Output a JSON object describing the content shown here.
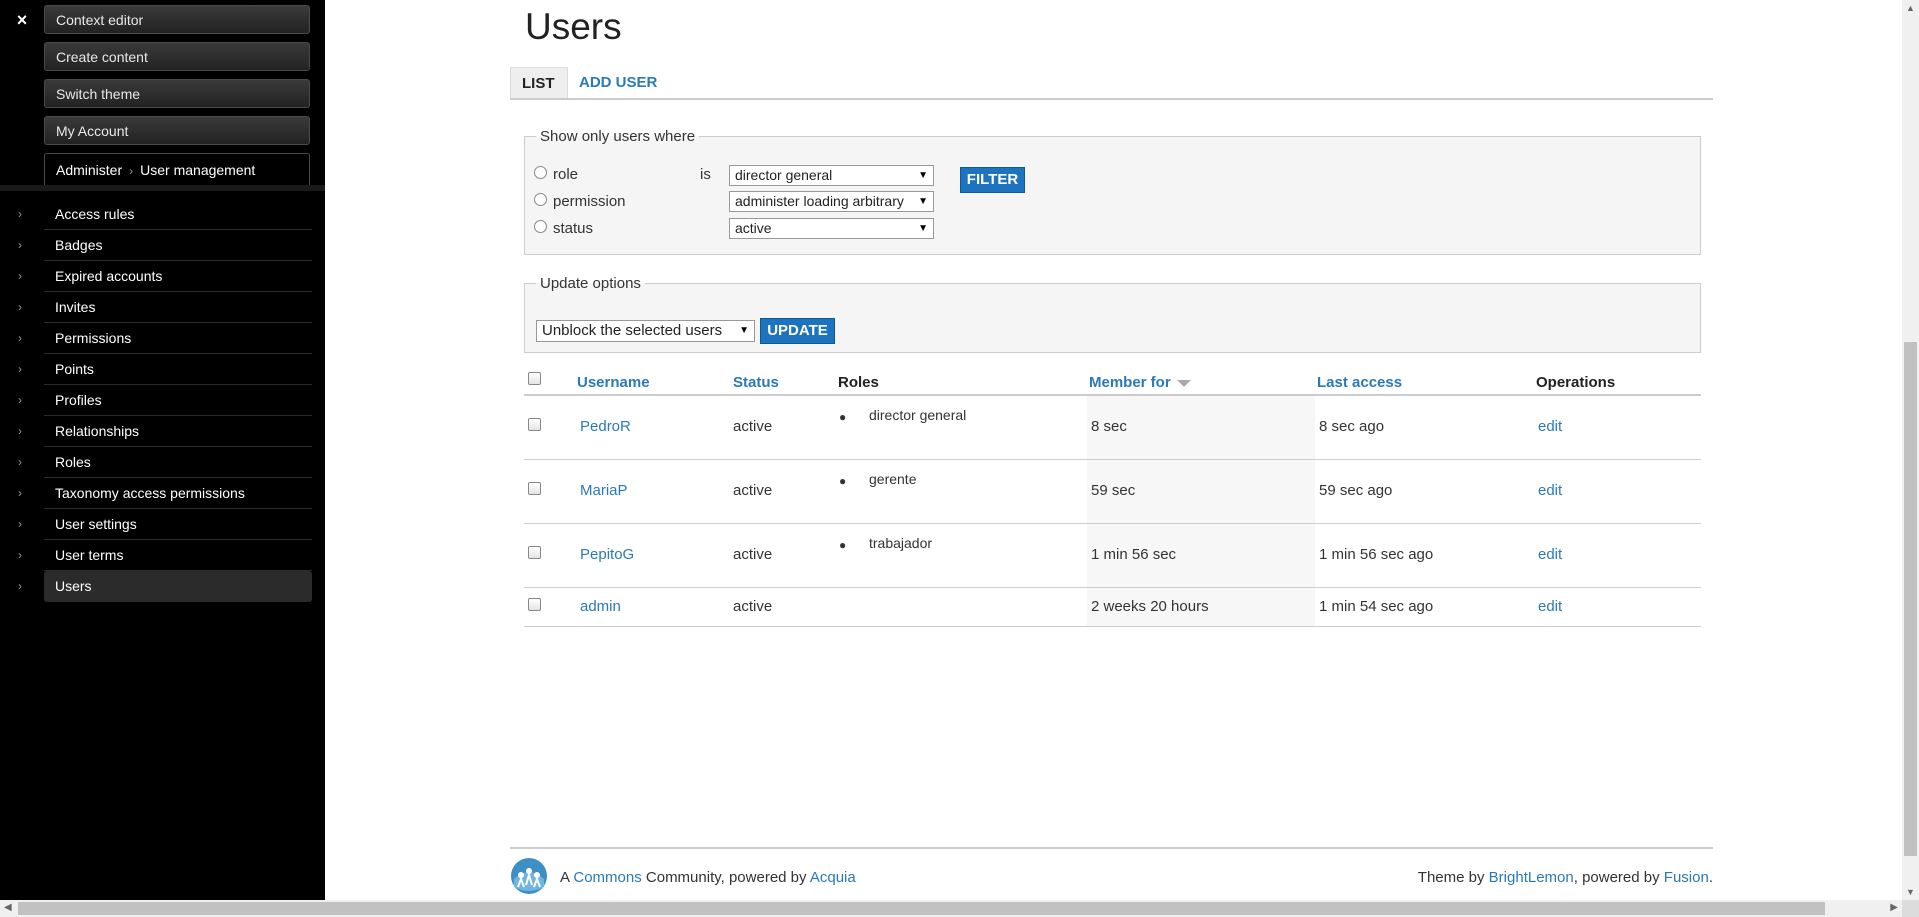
{
  "sidebar": {
    "close": "×",
    "top_buttons": [
      "Context editor",
      "Create content",
      "Switch theme",
      "My Account"
    ],
    "breadcrumb": {
      "parent": "Administer",
      "separator": "›",
      "current": "User management"
    },
    "items": [
      {
        "label": "Access rules"
      },
      {
        "label": "Badges"
      },
      {
        "label": "Expired accounts"
      },
      {
        "label": "Invites"
      },
      {
        "label": "Permissions"
      },
      {
        "label": "Points"
      },
      {
        "label": "Profiles"
      },
      {
        "label": "Relationships"
      },
      {
        "label": "Roles"
      },
      {
        "label": "Taxonomy access permissions"
      },
      {
        "label": "User settings"
      },
      {
        "label": "User terms"
      },
      {
        "label": "Users"
      }
    ],
    "item_arrow": "›"
  },
  "main": {
    "title": "Users",
    "tabs": [
      "List",
      "Add user"
    ],
    "filter": {
      "legend": "Show only users where",
      "rows": [
        {
          "label": "role",
          "operator": "is",
          "value": "director general"
        },
        {
          "label": "permission",
          "operator": "",
          "value": "administer loading arbitrary"
        },
        {
          "label": "status",
          "operator": "",
          "value": "active"
        }
      ],
      "button": "Filter"
    },
    "update": {
      "legend": "Update options",
      "selected": "Unblock the selected users",
      "button": "Update"
    },
    "table": {
      "headers": {
        "username": "Username",
        "status": "Status",
        "roles": "Roles",
        "member_for": "Member for",
        "last_access": "Last access",
        "operations": "Operations"
      },
      "rows": [
        {
          "username": "PedroR",
          "status": "active",
          "role": "director general",
          "member_for": "8 sec",
          "last_access": "8 sec ago",
          "op": "edit"
        },
        {
          "username": "MariaP",
          "status": "active",
          "role": "gerente",
          "member_for": "59 sec",
          "last_access": "59 sec ago",
          "op": "edit"
        },
        {
          "username": "PepitoG",
          "status": "active",
          "role": "trabajador",
          "member_for": "1 min 56 sec",
          "last_access": "1 min 56 sec ago",
          "op": "edit"
        },
        {
          "username": "admin",
          "status": "active",
          "role": "",
          "member_for": "2 weeks 20 hours",
          "last_access": "1 min 54 sec ago",
          "op": "edit"
        }
      ]
    }
  },
  "footer": {
    "left": {
      "prefix": "A",
      "commons": "Commons",
      "middle": "Community, powered by",
      "acquia": "Acquia"
    },
    "right": {
      "prefix": "Theme by",
      "brightlemon": "BrightLemon",
      "middle": ", powered by",
      "fusion": "Fusion",
      "suffix": "."
    }
  },
  "colors": {
    "link": "#2a7ab8",
    "button": "#1e73be",
    "sidebar_bg": "#000000"
  }
}
